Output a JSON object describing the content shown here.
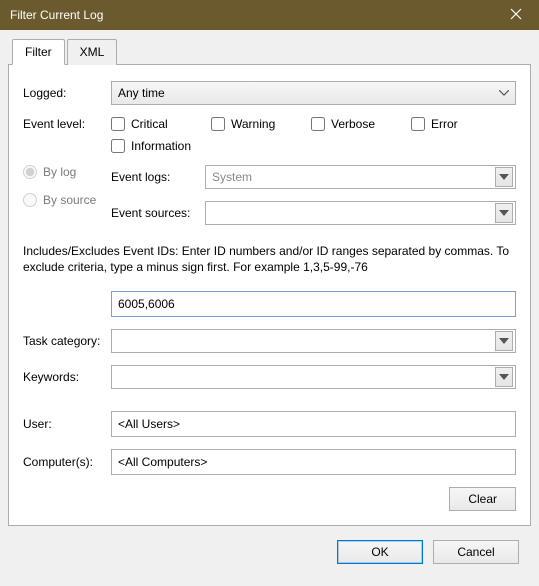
{
  "title": "Filter Current Log",
  "tabs": {
    "filter": "Filter",
    "xml": "XML"
  },
  "labels": {
    "logged": "Logged:",
    "eventLevel": "Event level:",
    "byLog": "By log",
    "bySource": "By source",
    "eventLogs": "Event logs:",
    "eventSources": "Event sources:",
    "taskCategory": "Task category:",
    "keywords": "Keywords:",
    "user": "User:",
    "computers": "Computer(s):"
  },
  "loggedValue": "Any time",
  "levels": {
    "critical": "Critical",
    "warning": "Warning",
    "verbose": "Verbose",
    "error": "Error",
    "information": "Information"
  },
  "eventLogsValue": "System",
  "eventSourcesValue": "",
  "instructions": "Includes/Excludes Event IDs: Enter ID numbers and/or ID ranges separated by commas. To exclude criteria, type a minus sign first. For example 1,3,5-99,-76",
  "eventIds": "6005,6006",
  "taskCategoryValue": "",
  "keywordsValue": "",
  "userValue": "<All Users>",
  "computersValue": "<All Computers>",
  "buttons": {
    "clear": "Clear",
    "ok": "OK",
    "cancel": "Cancel"
  }
}
